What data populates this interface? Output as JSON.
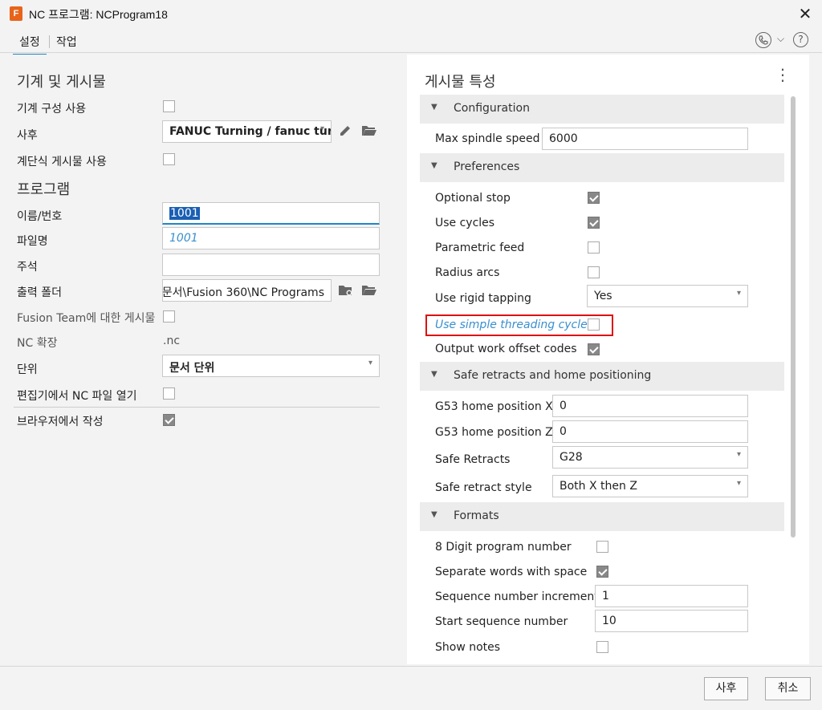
{
  "window": {
    "title": "NC 프로그램: NCProgram18",
    "app_icon": "F"
  },
  "tabs": [
    {
      "label": "설정"
    },
    {
      "label": "작업"
    }
  ],
  "left": {
    "machine_section": "기계 및 게시물",
    "use_machine_config": {
      "label": "기계 구성 사용",
      "checked": false
    },
    "post": {
      "label": "사후",
      "value": "FANUC Turning / fanuc turn"
    },
    "use_cascading_post": {
      "label": "계단식 게시물 사용",
      "checked": false
    },
    "program_section": "프로그램",
    "name_number": {
      "label": "이름/번호",
      "value": "1001"
    },
    "filename": {
      "label": "파일명",
      "value": "1001"
    },
    "comment": {
      "label": "주석",
      "value": ""
    },
    "output_folder": {
      "label": "출력 폴더",
      "value": "문서\\Fusion 360\\NC Programs"
    },
    "fusion_team_post": {
      "label": "Fusion Team에 대한 게시물",
      "checked": false
    },
    "nc_extension": {
      "label": "NC 확장",
      "value": ".nc"
    },
    "unit": {
      "label": "단위",
      "value": "문서 단위"
    },
    "open_in_editor": {
      "label": "편집기에서 NC 파일 열기",
      "checked": false
    },
    "create_in_browser": {
      "label": "브라우저에서 작성",
      "checked": true
    }
  },
  "right": {
    "title": "게시물 특성",
    "groups": {
      "configuration": "Configuration",
      "preferences": "Preferences",
      "safe_retracts": "Safe retracts and home positioning",
      "formats": "Formats"
    },
    "max_spindle_speed": {
      "label": "Max spindle speed",
      "value": "6000"
    },
    "optional_stop": {
      "label": "Optional stop",
      "checked": true
    },
    "use_cycles": {
      "label": "Use cycles",
      "checked": true
    },
    "parametric_feed": {
      "label": "Parametric feed",
      "checked": false
    },
    "radius_arcs": {
      "label": "Radius arcs",
      "checked": false
    },
    "use_rigid_tapping": {
      "label": "Use rigid tapping",
      "value": "Yes"
    },
    "use_simple_threading_cycle": {
      "label": "Use simple threading cycle",
      "checked": false
    },
    "output_work_offset_codes": {
      "label": "Output work offset codes",
      "checked": true
    },
    "g53_home_x": {
      "label": "G53 home position X",
      "value": "0"
    },
    "g53_home_z": {
      "label": "G53 home position Z",
      "value": "0"
    },
    "safe_retracts": {
      "label": "Safe Retracts",
      "value": "G28"
    },
    "safe_retract_style": {
      "label": "Safe retract style",
      "value": "Both X then Z"
    },
    "digit8_program_number": {
      "label": "8 Digit program number",
      "checked": false
    },
    "separate_words_with_space": {
      "label": "Separate words with space",
      "checked": true
    },
    "sequence_number_increment": {
      "label": "Sequence number increment",
      "value": "1"
    },
    "start_sequence_number": {
      "label": "Start sequence number",
      "value": "10"
    },
    "show_notes": {
      "label": "Show notes",
      "checked": false
    }
  },
  "footer": {
    "post_button": "사후",
    "cancel_button": "취소"
  },
  "colors": {
    "accent": "#1e88c8",
    "highlight": "#dd1111",
    "checkbox_checked": "#888888"
  }
}
